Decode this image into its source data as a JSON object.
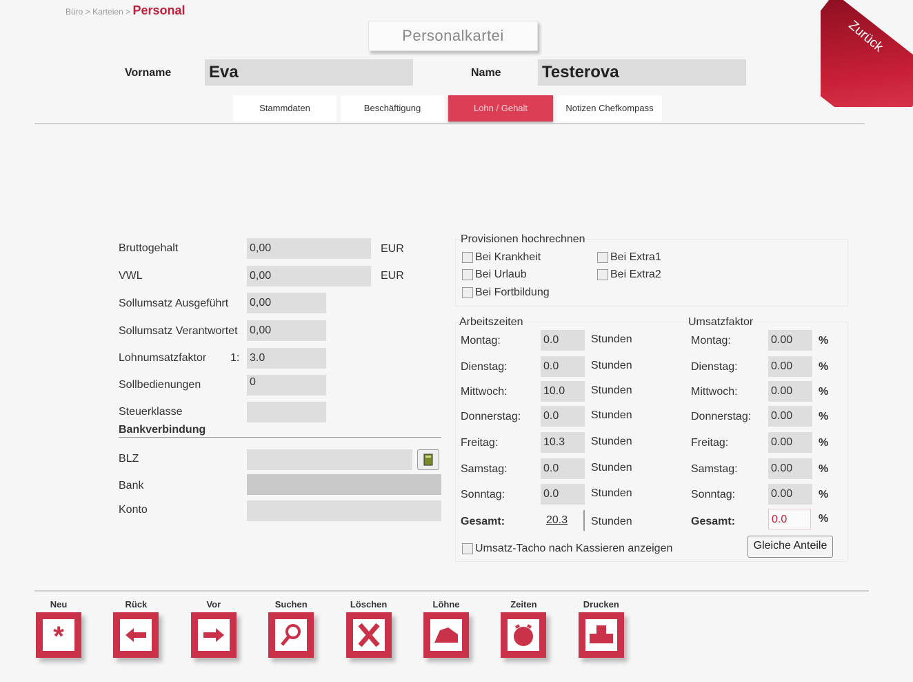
{
  "breadcrumb": {
    "root": "Büro",
    "sep1": ">",
    "mid": "Karteien",
    "sep2": ">",
    "current": "Personal"
  },
  "title": "Personalkartei",
  "back_label": "Zurück",
  "person": {
    "vorname_label": "Vorname",
    "vorname": "Eva",
    "name_label": "Name",
    "name": "Testerova"
  },
  "tabs": [
    "Stammdaten",
    "Beschäftigung",
    "Lohn / Gehalt",
    "Notizen Chefkompass"
  ],
  "active_tab": "Lohn / Gehalt",
  "lohn": {
    "brutto_label": "Bruttogehalt",
    "brutto": "0,00",
    "brutto_unit": "EUR",
    "vwl_label": "VWL",
    "vwl": "0,00",
    "vwl_unit": "EUR",
    "soll_ausgefuehrt_label": "Sollumsatz Ausgeführt",
    "soll_ausgefuehrt": "0,00",
    "soll_verantwortet_label": "Sollumsatz Verantwortet",
    "soll_verantwortet": "0,00",
    "faktor_label": "Lohnumsatzfaktor",
    "faktor_prefix": "1:",
    "faktor": "3.0",
    "sollbedienungen_label": "Sollbedienungen",
    "sollbedienungen": "0",
    "steuerklasse_label": "Steuerklasse",
    "steuerklasse": ""
  },
  "bank": {
    "heading": "Bankverbindung",
    "blz_label": "BLZ",
    "blz": "",
    "bank_label": "Bank",
    "bank": "",
    "konto_label": "Konto",
    "konto": ""
  },
  "provisionen": {
    "heading": "Provisionen hochrechnen",
    "options": [
      {
        "label": "Bei Krankheit",
        "checked": false
      },
      {
        "label": "Bei Urlaub",
        "checked": false
      },
      {
        "label": "Bei Fortbildung",
        "checked": false
      },
      {
        "label": "Bei Extra1",
        "checked": false
      },
      {
        "label": "Bei Extra2",
        "checked": false
      }
    ]
  },
  "arbeitszeiten": {
    "heading": "Arbeitszeiten",
    "unit": "Stunden",
    "days": [
      {
        "label": "Montag:",
        "value": "0.0"
      },
      {
        "label": "Dienstag:",
        "value": "0.0"
      },
      {
        "label": "Mittwoch:",
        "value": "10.0"
      },
      {
        "label": "Donnerstag:",
        "value": "0.0"
      },
      {
        "label": "Freitag:",
        "value": "10.3"
      },
      {
        "label": "Samstag:",
        "value": "0.0"
      },
      {
        "label": "Sonntag:",
        "value": "0.0"
      }
    ],
    "total_label": "Gesamt:",
    "total": "20.3"
  },
  "umsatzfaktor": {
    "heading": "Umsatzfaktor",
    "unit": "%",
    "days": [
      {
        "label": "Montag:",
        "value": "0.00"
      },
      {
        "label": "Dienstag:",
        "value": "0.00"
      },
      {
        "label": "Mittwoch:",
        "value": "0.00"
      },
      {
        "label": "Donnerstag:",
        "value": "0.00"
      },
      {
        "label": "Freitag:",
        "value": "0.00"
      },
      {
        "label": "Samstag:",
        "value": "0.00"
      },
      {
        "label": "Sonntag:",
        "value": "0.00"
      }
    ],
    "total_label": "Gesamt:",
    "total": "0.0",
    "total_color": "#c2203a"
  },
  "tacho_label": "Umsatz-Tacho nach Kassieren anzeigen",
  "gleiche_label": "Gleiche Anteile",
  "toolbar": [
    {
      "label": "Neu",
      "icon": "asterisk-icon"
    },
    {
      "label": "Rück",
      "icon": "arrow-left-icon"
    },
    {
      "label": "Vor",
      "icon": "arrow-right-icon"
    },
    {
      "label": "Suchen",
      "icon": "magnifier-icon"
    },
    {
      "label": "Löschen",
      "icon": "x-icon"
    },
    {
      "label": "Löhne",
      "icon": "money-icon"
    },
    {
      "label": "Zeiten",
      "icon": "clock-icon"
    },
    {
      "label": "Drucken",
      "icon": "printer-icon"
    }
  ],
  "colors": {
    "accent": "#c93248",
    "tab_active": "#dc3e56",
    "field": "#dedede"
  }
}
